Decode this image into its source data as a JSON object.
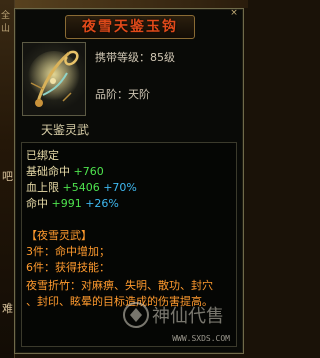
{
  "background": {
    "top_fragment": "全 山",
    "left_fragment_1": "吧",
    "left_fragment_2": "难"
  },
  "tooltip": {
    "title": "夜雪天鉴玉钩",
    "close_symbol": "×",
    "level_label": "携带等级：85级",
    "grade_label": "品阶：天阶",
    "set_name_header": "天鉴灵武",
    "bound_status": "已绑定",
    "stats": [
      {
        "label": "基础命中",
        "value": "+760",
        "percent": ""
      },
      {
        "label": "血上限",
        "value": "+5406",
        "percent": "+70%"
      },
      {
        "label": "命中",
        "value": "+991",
        "percent": "+26%"
      }
    ],
    "set_title": "【夜雪灵武】",
    "set_bonus_3": "3件：命中增加；",
    "set_bonus_6": "6件：获得技能：",
    "skill_desc_1": "夜雪折竹：对麻痹、失明、散功、封穴",
    "skill_desc_2": "、封印、眩晕的目标造成的伤害提高。"
  },
  "watermark": {
    "logo_text": "神仙代售",
    "url": "WWW.SXDS.COM"
  },
  "colors": {
    "title": "#e04a1a",
    "green_stat": "#4ee34e",
    "cyan_percent": "#3fb8f0",
    "orange_set": "#ff9a2e",
    "panel_border": "#6f6a4a"
  }
}
